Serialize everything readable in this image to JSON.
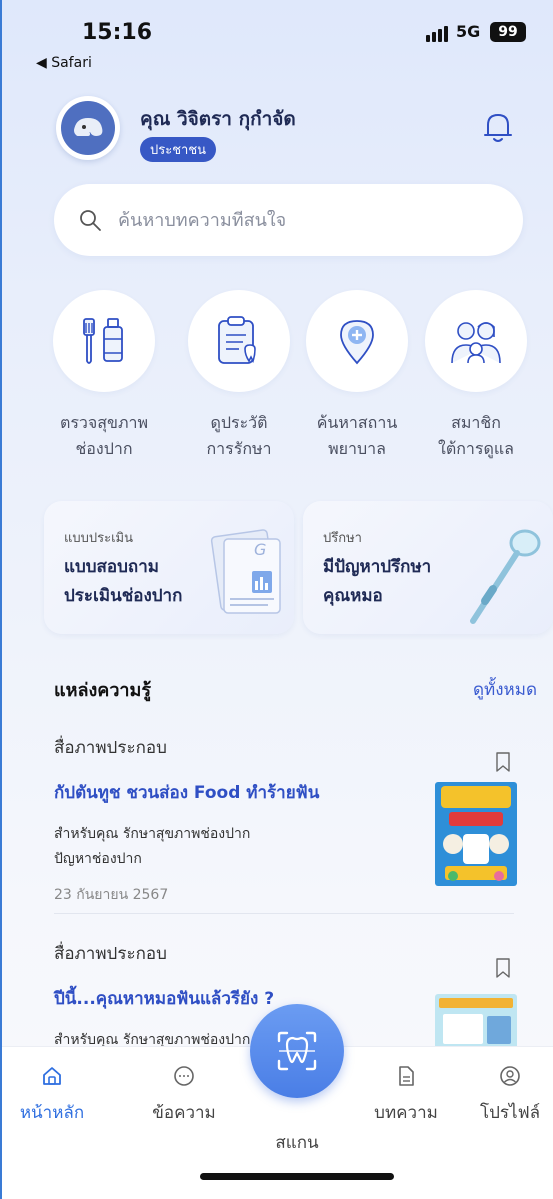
{
  "status_bar": {
    "time": "15:16",
    "back_app": "◀ Safari",
    "network": "5G",
    "battery": "99"
  },
  "header": {
    "user_name": "คุณ วิจิตรา กุกำจัด",
    "user_role": "ประชาชน"
  },
  "search": {
    "placeholder": "ค้นหาบทความที่สนใจ"
  },
  "quick_actions": [
    {
      "label_line1": "ตรวจสุขภาพ",
      "label_line2": "ช่องปาก",
      "icon": "toothbrush-icon"
    },
    {
      "label_line1": "ดูประวัติ",
      "label_line2": "การรักษา",
      "icon": "clipboard-icon"
    },
    {
      "label_line1": "ค้นหาสถาน",
      "label_line2": "พยาบาล",
      "icon": "location-pin-icon"
    },
    {
      "label_line1": "สมาชิก",
      "label_line2": "ใต้การดูแล",
      "icon": "family-icon"
    }
  ],
  "feature_cards": [
    {
      "tag": "แบบประเมิน",
      "title_line1": "แบบสอบถาม",
      "title_line2": "ประเมินช่องปาก",
      "icon": "document-chart-icon"
    },
    {
      "tag": "ปรึกษา",
      "title_line1": "มีปัญหาปรึกษา",
      "title_line2": "คุณหมอ",
      "icon": "dental-mirror-icon"
    }
  ],
  "knowledge": {
    "title": "แหล่งความรู้",
    "see_all": "ดูทั้งหมด",
    "articles": [
      {
        "type": "สื่อภาพประกอบ",
        "title": "กัปตันทูช ชวนส่อง Food ทำร้ายฟัน",
        "meta_line1": "สำหรับคุณ  รักษาสุขภาพช่องปาก",
        "meta_line2": "ปัญหาช่องปาก",
        "date": "23 กันยายน 2567"
      },
      {
        "type": "สื่อภาพประกอบ",
        "title": "ปีนี้...คุณหาหมอฟันแล้วรียัง ?",
        "meta_line1": "สำหรับคุณ  รักษาสุขภาพช่องปาก",
        "meta_line2": "",
        "date": ""
      }
    ]
  },
  "bottom_nav": {
    "items": [
      {
        "label": "หน้าหลัก",
        "icon": "home-icon",
        "active": true
      },
      {
        "label": "ข้อความ",
        "icon": "chat-icon",
        "active": false
      },
      {
        "label": "สแกน",
        "icon": "tooth-scan-icon",
        "active": false
      },
      {
        "label": "บทความ",
        "icon": "article-icon",
        "active": false
      },
      {
        "label": "โปรไฟล์",
        "icon": "profile-icon",
        "active": false
      }
    ]
  },
  "colors": {
    "primary": "#3758c5",
    "link": "#2f4fc4",
    "nav_active": "#2f6fe0",
    "scan": "#5a8cec"
  }
}
